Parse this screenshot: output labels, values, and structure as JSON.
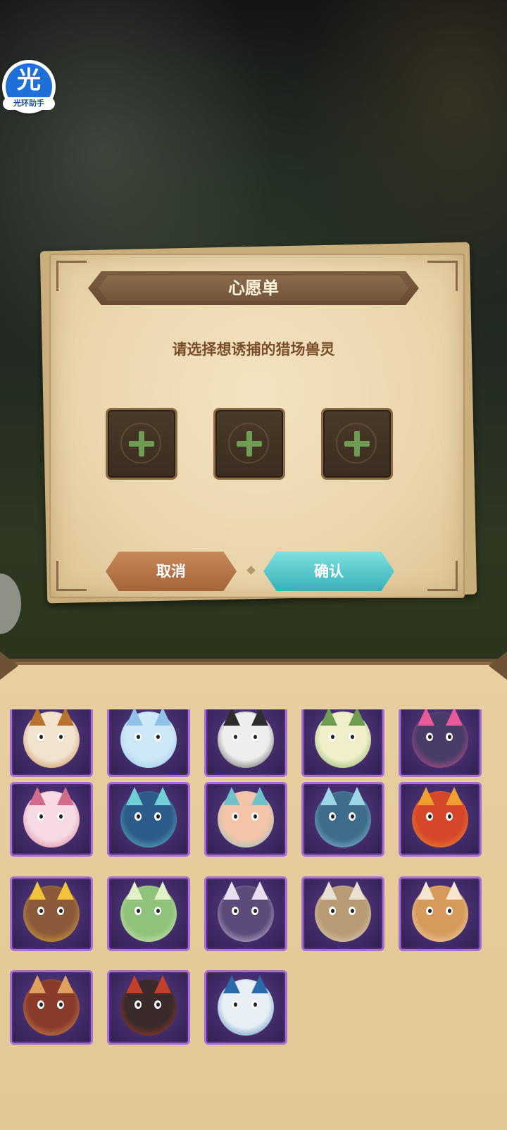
{
  "assistant_badge": {
    "glyph": "光",
    "label": "光环助手"
  },
  "dialog": {
    "title": "心愿单",
    "subtitle": "请选择想诱捕的猎场兽灵",
    "slots": [
      {
        "icon": "plus-icon"
      },
      {
        "icon": "plus-icon"
      },
      {
        "icon": "plus-icon"
      }
    ],
    "cancel_label": "取消",
    "confirm_label": "确认"
  },
  "colors": {
    "panel": "#e8cfa0",
    "card_border": "#a86dd6",
    "cancel": "#b87347",
    "confirm": "#52c6cc",
    "plus": "#6e9d53"
  },
  "creature_grid": [
    {
      "id": "creature-1",
      "base": "#f2e3cf",
      "accent": "#b8742f"
    },
    {
      "id": "creature-2",
      "base": "#cde8f7",
      "accent": "#8fc2e6"
    },
    {
      "id": "creature-3",
      "base": "#eeeeee",
      "accent": "#2d2d2d"
    },
    {
      "id": "creature-4",
      "base": "#f1efc9",
      "accent": "#6e9d53"
    },
    {
      "id": "creature-5",
      "base": "#4a3c69",
      "accent": "#e85a9a"
    },
    {
      "id": "creature-6",
      "base": "#f6dbe4",
      "accent": "#d26a8a"
    },
    {
      "id": "creature-7",
      "base": "#2d5b8a",
      "accent": "#6fd0d6"
    },
    {
      "id": "creature-8",
      "base": "#f4c4a8",
      "accent": "#6fc0c8"
    },
    {
      "id": "creature-9",
      "base": "#3d6c8c",
      "accent": "#9dd6e6"
    },
    {
      "id": "creature-10",
      "base": "#d6462a",
      "accent": "#f0a030"
    },
    {
      "id": "creature-11",
      "base": "#8a5a3a",
      "accent": "#f2c33a"
    },
    {
      "id": "creature-12",
      "base": "#8fc27a",
      "accent": "#e2f0c8"
    },
    {
      "id": "creature-13",
      "base": "#5c4a7a",
      "accent": "#e8e0f0"
    },
    {
      "id": "creature-14",
      "base": "#b89a74",
      "accent": "#e8e0d0"
    },
    {
      "id": "creature-15",
      "base": "#d69a5a",
      "accent": "#f6e6d0"
    },
    {
      "id": "creature-16",
      "base": "#8a3a2a",
      "accent": "#e0a060"
    },
    {
      "id": "creature-17",
      "base": "#3a2a2a",
      "accent": "#c0402a"
    },
    {
      "id": "creature-18",
      "base": "#e8f0f6",
      "accent": "#2a6aa8"
    }
  ]
}
